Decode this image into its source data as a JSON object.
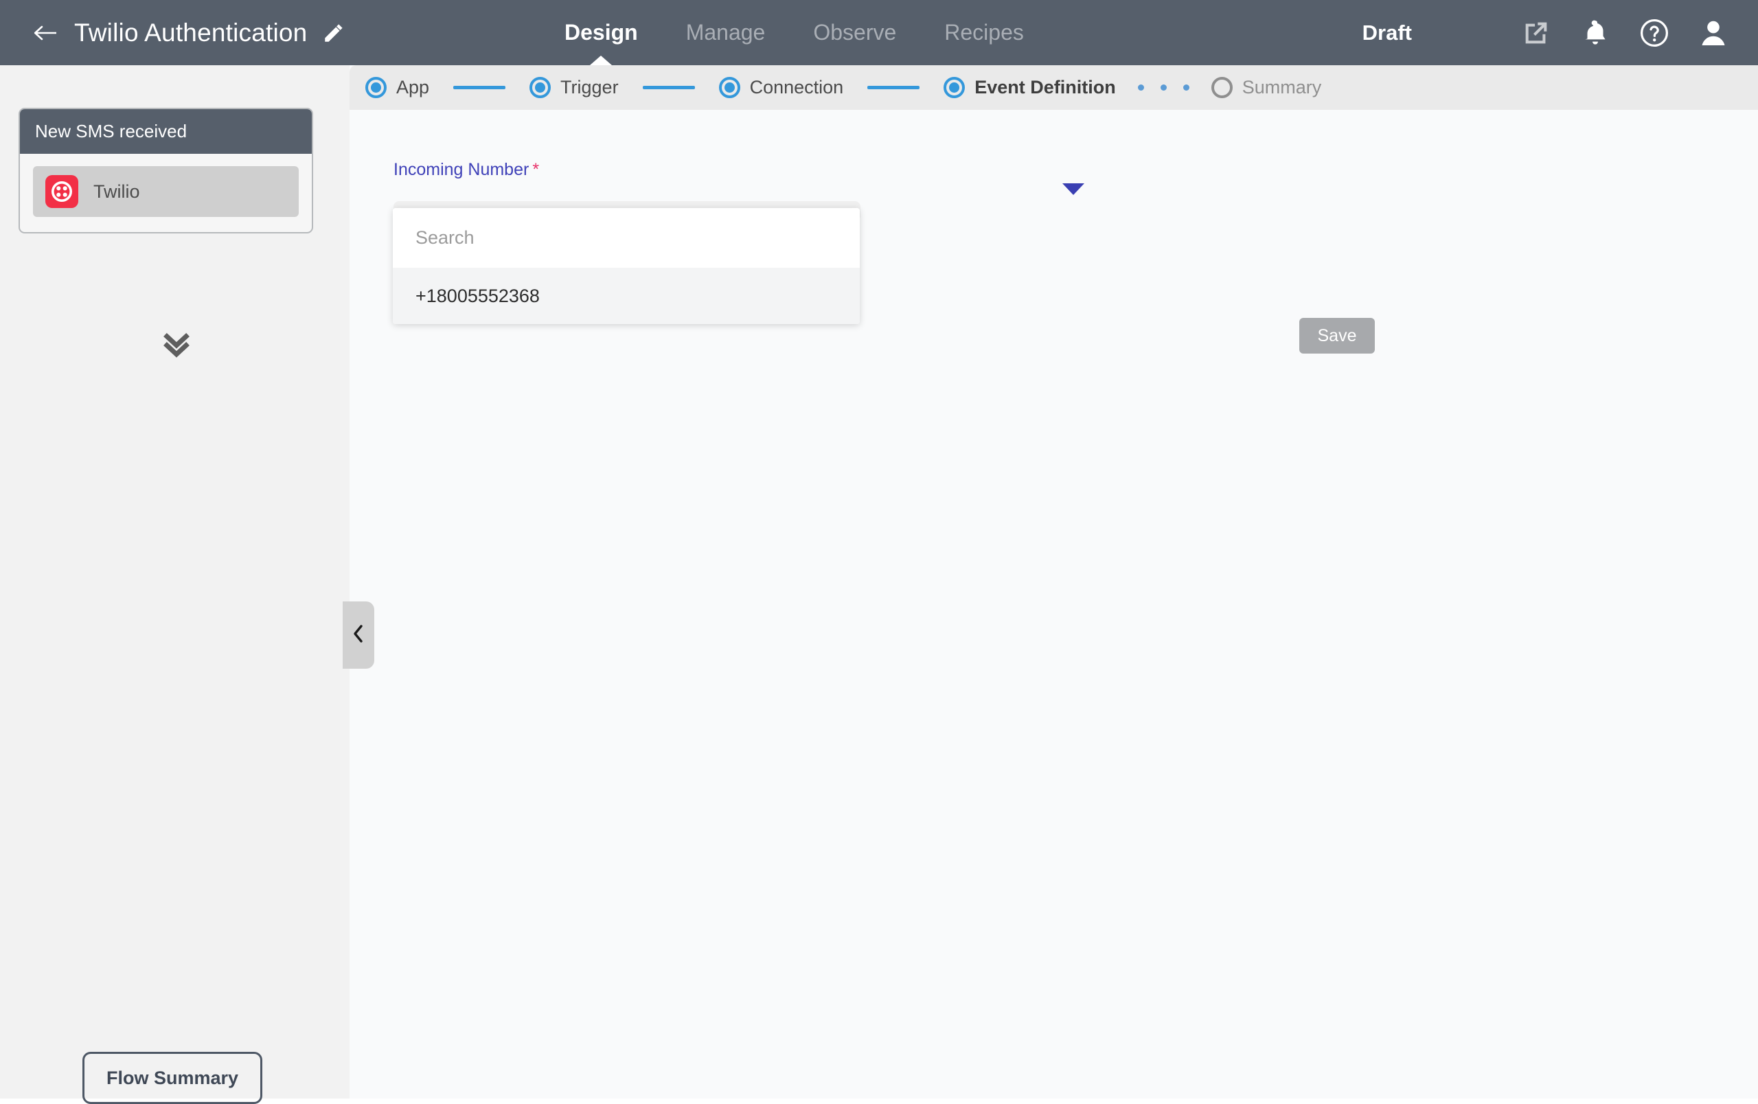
{
  "header": {
    "back_icon": "back-arrow-icon",
    "flow_title": "Twilio Authentication",
    "edit_icon": "pencil-icon",
    "tabs": [
      {
        "label": "Design",
        "active": true
      },
      {
        "label": "Manage",
        "active": false
      },
      {
        "label": "Observe",
        "active": false
      },
      {
        "label": "Recipes",
        "active": false
      }
    ],
    "status": "Draft",
    "icons": [
      {
        "name": "external-link-icon"
      },
      {
        "name": "bell-icon"
      },
      {
        "name": "help-circle-icon"
      },
      {
        "name": "user-avatar-icon"
      }
    ],
    "bg_color": "#565f6b"
  },
  "left_panel": {
    "node_card": {
      "title": "New SMS received",
      "app_name": "Twilio",
      "app_icon": "twilio-logo-icon",
      "app_color": "#f22f46"
    },
    "expand_icon": "double-chevron-down-icon",
    "flow_summary_label": "Flow Summary",
    "bg_color": "#f2f2f2"
  },
  "collapse_handle": {
    "icon": "chevron-left-icon"
  },
  "stepper": {
    "accent_color": "#3498db",
    "steps": [
      {
        "label": "App",
        "state": "done"
      },
      {
        "label": "Trigger",
        "state": "done"
      },
      {
        "label": "Connection",
        "state": "done"
      },
      {
        "label": "Event Definition",
        "state": "current"
      },
      {
        "label": "Summary",
        "state": "pending"
      }
    ]
  },
  "form": {
    "field_label": "Incoming Number",
    "required_marker": "*",
    "label_color": "#3f41b8",
    "dropdown": {
      "caret_icon": "chevron-down-icon",
      "search_placeholder": "Search",
      "search_value": "",
      "options": [
        "+18005552368"
      ]
    },
    "save_label": "Save",
    "save_disabled_color": "#a7a9ac"
  }
}
